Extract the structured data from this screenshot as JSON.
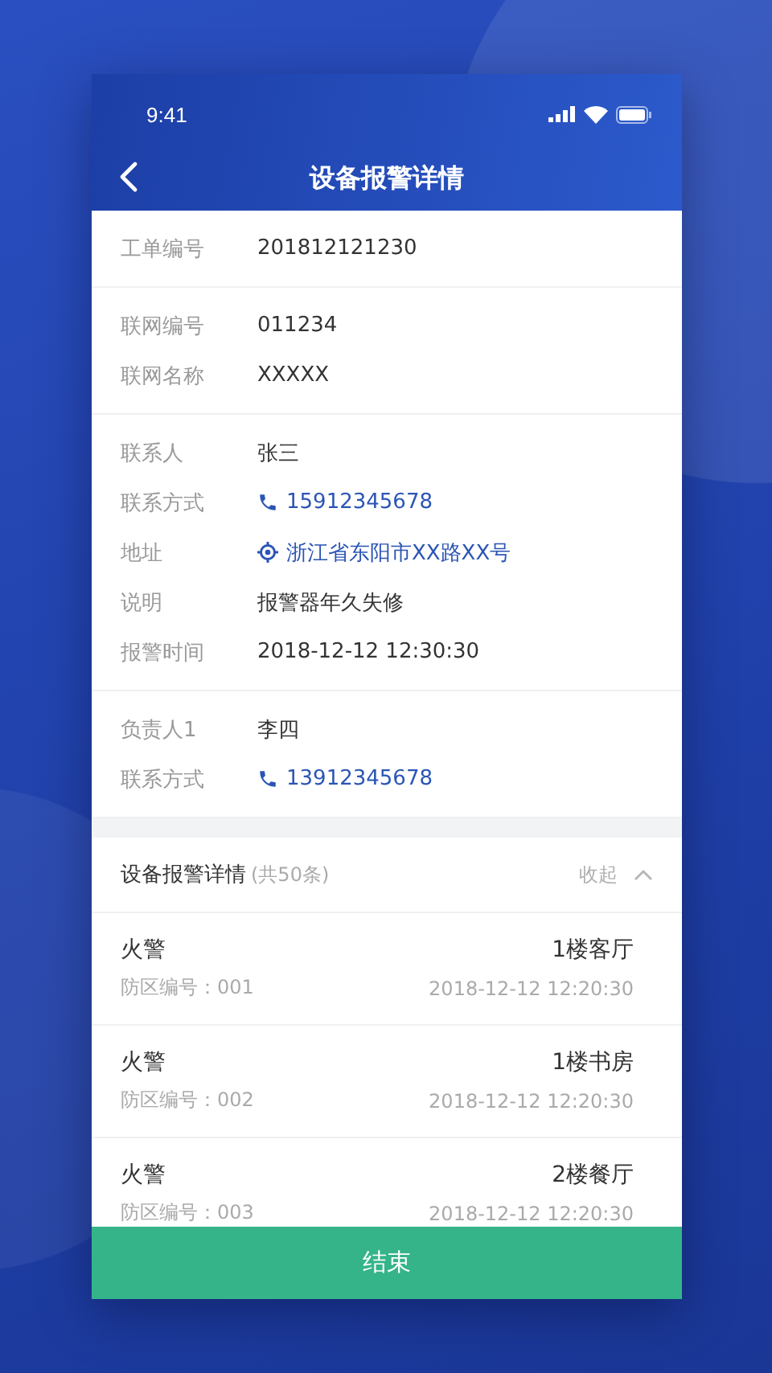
{
  "status_bar": {
    "time": "9:41"
  },
  "nav": {
    "title": "设备报警详情"
  },
  "sections": [
    {
      "rows": [
        {
          "label": "工单编号",
          "value": "201812121230",
          "kind": "text"
        }
      ]
    },
    {
      "rows": [
        {
          "label": "联网编号",
          "value": "011234",
          "kind": "text"
        },
        {
          "label": "联网名称",
          "value": "XXXXX",
          "kind": "text"
        }
      ]
    },
    {
      "rows": [
        {
          "label": "联系人",
          "value": "张三",
          "kind": "text"
        },
        {
          "label": "联系方式",
          "value": "15912345678",
          "kind": "phone"
        },
        {
          "label": "地址",
          "value": "浙江省东阳市XX路XX号",
          "kind": "address"
        },
        {
          "label": "说明",
          "value": "报警器年久失修",
          "kind": "text"
        },
        {
          "label": "报警时间",
          "value": "2018-12-12 12:30:30",
          "kind": "text"
        }
      ]
    },
    {
      "rows": [
        {
          "label": "负责人1",
          "value": "李四",
          "kind": "text"
        },
        {
          "label": "联系方式",
          "value": "13912345678",
          "kind": "phone"
        }
      ]
    }
  ],
  "alarm_list": {
    "title": "设备报警详情",
    "count": "(共50条)",
    "toggle": "收起",
    "expanded": true,
    "items": [
      {
        "type": "火警",
        "zone": "防区编号：001",
        "location": "1楼客厅",
        "time": "2018-12-12 12:20:30"
      },
      {
        "type": "火警",
        "zone": "防区编号：002",
        "location": "1楼书房",
        "time": "2018-12-12 12:20:30"
      },
      {
        "type": "火警",
        "zone": "防区编号：003",
        "location": "2楼餐厅",
        "time": "2018-12-12 12:20:30"
      }
    ]
  },
  "button": "结束"
}
